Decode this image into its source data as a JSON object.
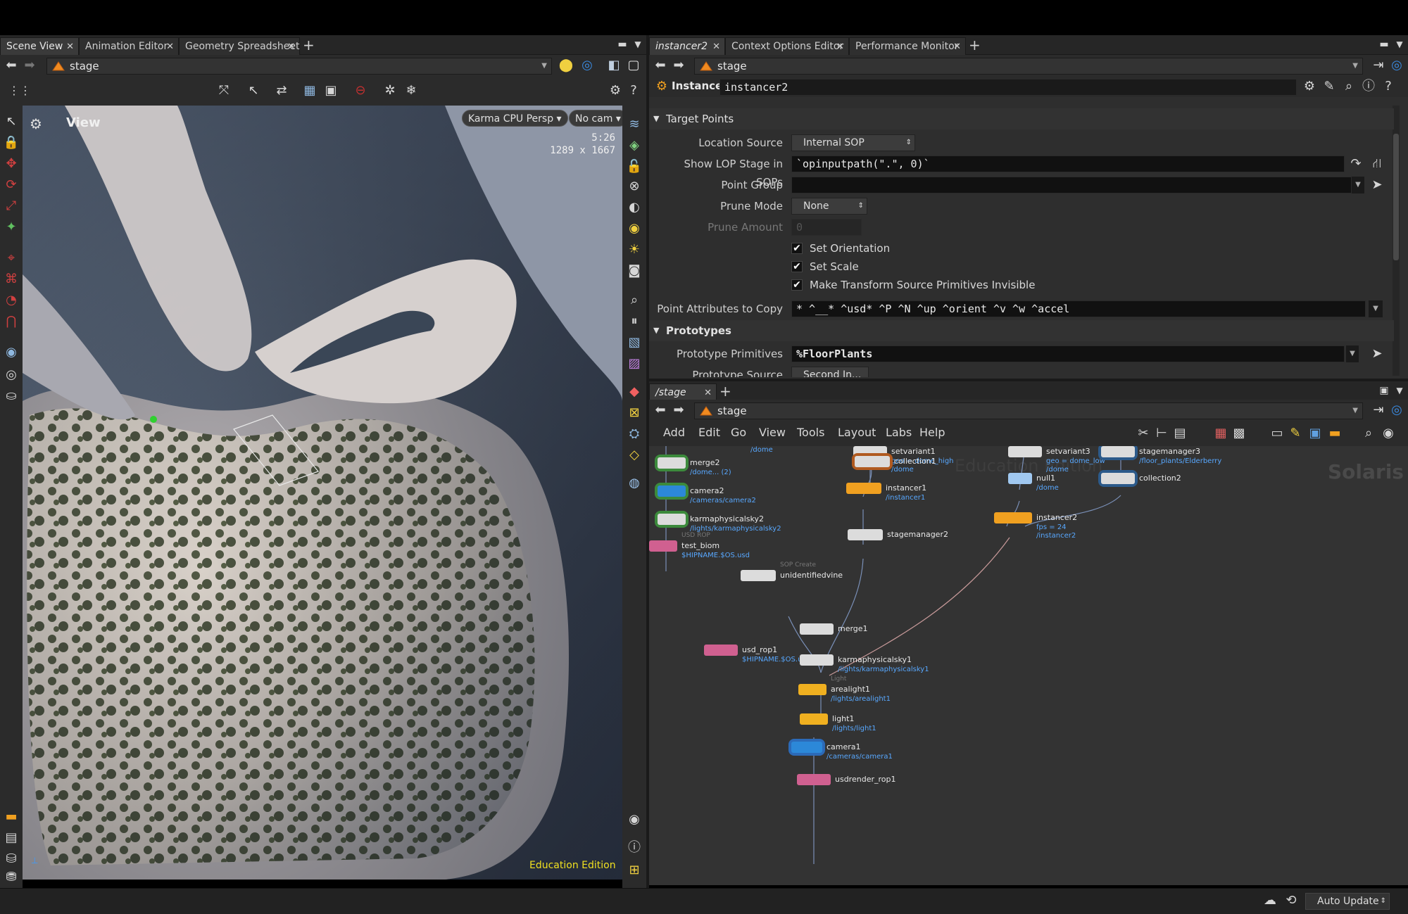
{
  "left_tabs": [
    "Scene View",
    "Animation Editor",
    "Geometry Spreadsheet"
  ],
  "right_tabs": [
    "instancer2",
    "Context Options Editor",
    "Performance Monitor"
  ],
  "network_tab": "/stage",
  "path": {
    "left": "stage",
    "params": "stage",
    "network": "stage"
  },
  "viewport": {
    "label": "View",
    "renderer": "Karma CPU",
    "camera_mode": "Persp",
    "camera": "No cam",
    "time": "5:26",
    "resolution": "1289 x 1667",
    "edition": "Education Edition"
  },
  "params": {
    "node_type": "Instancer",
    "node_name": "instancer2",
    "sections": {
      "target_points": "Target Points",
      "prototypes": "Prototypes"
    },
    "labels": {
      "location_source": "Location Source",
      "show_lop_stage": "Show LOP Stage in SOPs",
      "point_group": "Point Group",
      "prune_mode": "Prune Mode",
      "prune_amount": "Prune Amount",
      "point_attributes": "Point Attributes to Copy",
      "prototype_primitives": "Prototype Primitives",
      "prototype_source": "Prototype Source"
    },
    "values": {
      "location_source": "Internal SOP",
      "show_lop_stage": "`opinputpath(\".\", 0)`",
      "point_group": "",
      "prune_mode": "None",
      "prune_amount": "0",
      "point_attributes": "* ^__* ^usd* ^P ^N ^up ^orient ^v ^w ^accel",
      "prototype_primitives": "%FloorPlants",
      "prototype_source": "Second In..."
    },
    "checks": [
      {
        "label": "Set Orientation",
        "checked": true
      },
      {
        "label": "Set Scale",
        "checked": true
      },
      {
        "label": "Make Transform Source Primitives Invisible",
        "checked": true
      }
    ]
  },
  "network_menu": [
    "Add",
    "Edit",
    "Go",
    "View",
    "Tools",
    "Layout",
    "Labs",
    "Help"
  ],
  "network_watermark": {
    "edition": "Education Edition",
    "context": "Solaris"
  },
  "nodes": [
    {
      "name": "merge2",
      "sub": "/dome... (2)",
      "color": "#dcdcdc",
      "ring": "#3c8a3c"
    },
    {
      "name": "camera2",
      "sub": "/cameras/camera2",
      "color": "#2c88d8",
      "ring": "#3c8a3c"
    },
    {
      "name": "karmaphysicalsky2",
      "sub": "/lights/karmaphysicalsky2",
      "color": "#dcdcdc",
      "ring": "#3c8a3c"
    },
    {
      "name": "test_biom",
      "sub": "$HIPNAME.$OS.usd",
      "type": "USD ROP",
      "color": "#d06090"
    },
    {
      "name": "setvariant1",
      "sub": "geo = dome_high",
      "sub2": "/dome",
      "color": "#dcdcdc"
    },
    {
      "name": "collection1",
      "color": "#dcdcdc",
      "ring": "#b05a20"
    },
    {
      "name": "instancer1",
      "sub": "/instancer1",
      "color": "#f0a020"
    },
    {
      "name": "stagemanager2",
      "color": "#dcdcdc"
    },
    {
      "name": "unidentifiedvine",
      "type": "SOP Create",
      "color": "#dcdcdc"
    },
    {
      "name": "merge1",
      "color": "#dcdcdc"
    },
    {
      "name": "usd_rop1",
      "sub": "$HIPNAME.$OS.usd",
      "color": "#d06090"
    },
    {
      "name": "karmaphysicalsky1",
      "sub": "/lights/karmaphysicalsky1",
      "color": "#dcdcdc"
    },
    {
      "name": "arealight1",
      "sub": "/lights/arealight1",
      "type": "Light",
      "color": "#f0b020"
    },
    {
      "name": "light1",
      "sub": "/lights/light1",
      "color": "#f0b020"
    },
    {
      "name": "camera1",
      "sub": "/cameras/camera1",
      "color": "#2c88d8",
      "ring": "#2c6ab8"
    },
    {
      "name": "usdrender_rop1",
      "color": "#d06090"
    },
    {
      "name": "setvariant3",
      "sub": "geo = dome_low",
      "sub2": "/dome",
      "color": "#dcdcdc"
    },
    {
      "name": "stagemanager3",
      "sub": "/floor_plants/Elderberry",
      "color": "#dcdcdc",
      "ring": "#2c5a8a"
    },
    {
      "name": "null1",
      "sub": "/dome",
      "color": "#a0c8f0"
    },
    {
      "name": "collection2",
      "color": "#dcdcdc",
      "ring": "#2c5a8a"
    },
    {
      "name": "instancer2",
      "sub": "fps = 24",
      "sub2": "/instancer2",
      "color": "#f0a020"
    }
  ],
  "dome_label": "/dome",
  "status": {
    "auto_update": "Auto Update"
  }
}
